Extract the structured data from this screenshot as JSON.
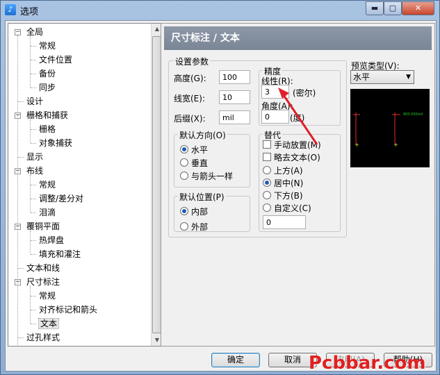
{
  "window": {
    "title": "选项",
    "min_glyph": "▬",
    "max_glyph": "▢",
    "close_glyph": "✕"
  },
  "tree": {
    "nodes": [
      {
        "label": "全局",
        "level": 0,
        "expander": "−"
      },
      {
        "label": "常规",
        "level": 1
      },
      {
        "label": "文件位置",
        "level": 1
      },
      {
        "label": "备份",
        "level": 1
      },
      {
        "label": "同步",
        "level": 1
      },
      {
        "label": "设计",
        "level": 0
      },
      {
        "label": "栅格和捕获",
        "level": 0,
        "expander": "−"
      },
      {
        "label": "栅格",
        "level": 1
      },
      {
        "label": "对象捕获",
        "level": 1
      },
      {
        "label": "显示",
        "level": 0
      },
      {
        "label": "布线",
        "level": 0,
        "expander": "−"
      },
      {
        "label": "常规",
        "level": 1
      },
      {
        "label": "调整/差分对",
        "level": 1
      },
      {
        "label": "泪滴",
        "level": 1
      },
      {
        "label": "覆铜平面",
        "level": 0,
        "expander": "−"
      },
      {
        "label": "热焊盘",
        "level": 1
      },
      {
        "label": "填充和灌注",
        "level": 1
      },
      {
        "label": "文本和线",
        "level": 0
      },
      {
        "label": "尺寸标注",
        "level": 0,
        "expander": "−"
      },
      {
        "label": "常规",
        "level": 1
      },
      {
        "label": "对齐标记和箭头",
        "level": 1
      },
      {
        "label": "文本",
        "level": 1,
        "selected": true
      },
      {
        "label": "过孔样式",
        "level": 0
      }
    ]
  },
  "panel": {
    "header": "尺寸标注 / 文本",
    "settings": {
      "legend": "设置参数",
      "height_label": "高度(G):",
      "height_value": "100",
      "width_label": "线宽(E):",
      "width_value": "10",
      "suffix_label": "后缀(X):",
      "suffix_value": "mil"
    },
    "precision": {
      "legend": "精度",
      "linear_label": "线性(R):",
      "linear_value": "3",
      "linear_unit": "(密尔)",
      "angle_label": "角度(A):",
      "angle_value": "0",
      "angle_unit": "(度)"
    },
    "direction": {
      "legend": "默认方向(O)",
      "options": [
        {
          "label": "水平",
          "checked": true
        },
        {
          "label": "垂直",
          "checked": false
        },
        {
          "label": "与箭头一样",
          "checked": false
        }
      ]
    },
    "position": {
      "legend": "默认位置(P)",
      "options": [
        {
          "label": "内部",
          "checked": true
        },
        {
          "label": "外部",
          "checked": false
        }
      ]
    },
    "override": {
      "legend": "替代",
      "checkboxes": [
        {
          "label": "手动放置(M)",
          "checked": false
        },
        {
          "label": "略去文本(O)",
          "checked": false
        }
      ],
      "radios": [
        {
          "label": "上方(A)",
          "checked": false
        },
        {
          "label": "居中(N)",
          "checked": true
        },
        {
          "label": "下方(B)",
          "checked": false
        },
        {
          "label": "自定义(C)",
          "checked": false
        }
      ],
      "custom_value": "0"
    },
    "preview": {
      "label": "预览类型(V):",
      "selected": "水平",
      "sample_text": "800.000mil"
    }
  },
  "buttons": {
    "ok": "确定",
    "cancel": "取消",
    "apply": "应用(A)",
    "help": "帮助(H)"
  },
  "watermark": "Pcbbar.com",
  "colors": {
    "arrow": "#e0202a",
    "preview_line": "#e03030",
    "preview_text": "#22cc22",
    "preview_mark": "#e6e62a"
  }
}
